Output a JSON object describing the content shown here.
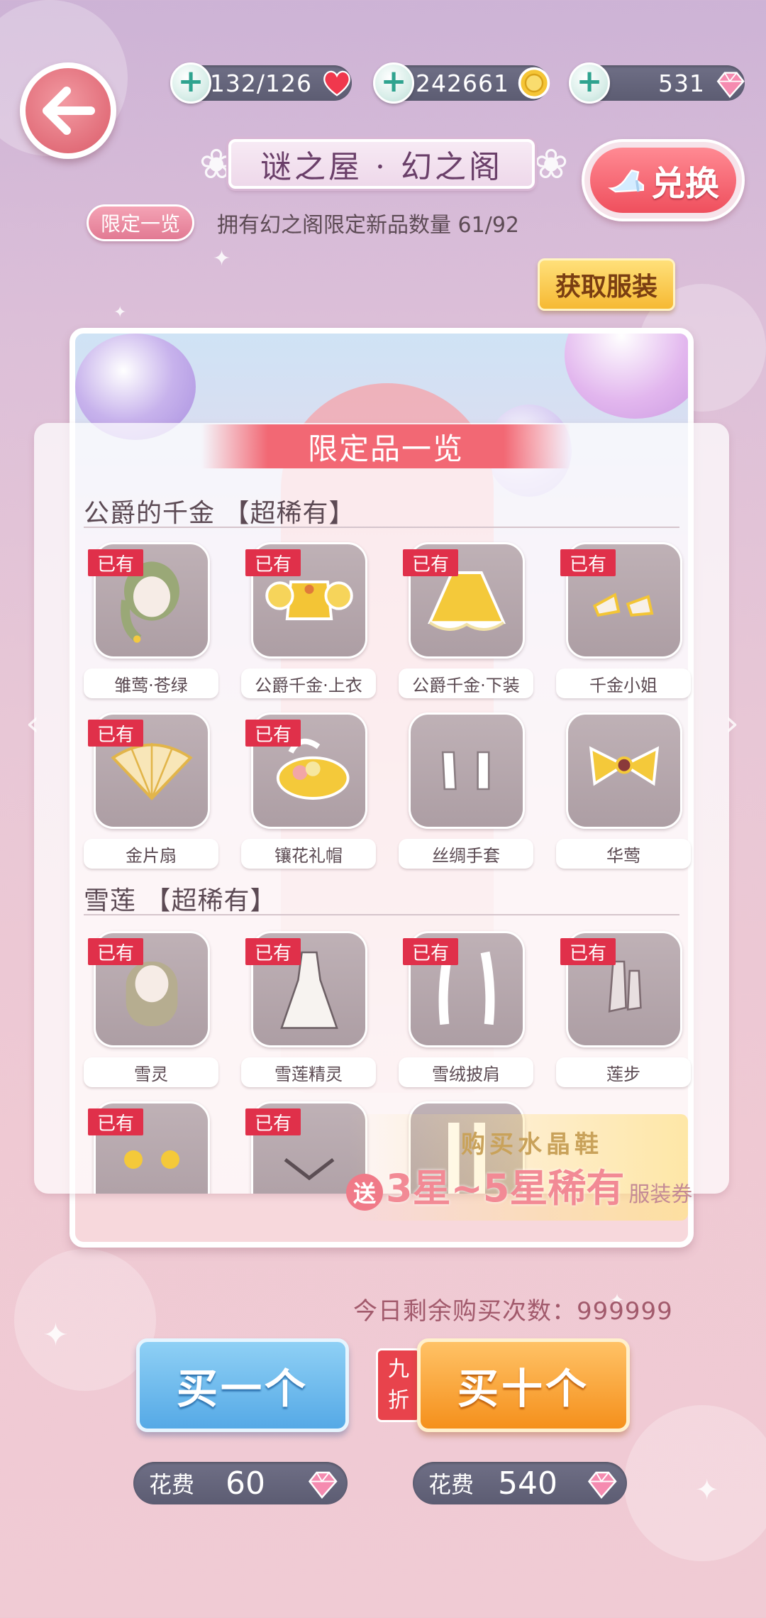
{
  "resources": {
    "stamina": "132/126",
    "gold": "242661",
    "diamonds": "531"
  },
  "header": {
    "title": "谜之屋 · 幻之阁",
    "exchange_label": "兑换",
    "limited_badge": "限定一览",
    "own_count": "拥有幻之阁限定新品数量 61/92",
    "get_clothes_label": "获取服装"
  },
  "panel": {
    "title": "限定品一览",
    "sections": [
      {
        "title": "公爵的千金 【超稀有】",
        "items": [
          {
            "name": "雏莺·苍绿",
            "owned": "已有",
            "icon": "hair-icon"
          },
          {
            "name": "公爵千金·上衣",
            "owned": "已有",
            "icon": "top-icon"
          },
          {
            "name": "公爵千金·下装",
            "owned": "已有",
            "icon": "skirt-icon"
          },
          {
            "name": "千金小姐",
            "owned": "已有",
            "icon": "shoes-icon"
          },
          {
            "name": "金片扇",
            "owned": "已有",
            "icon": "fan-icon"
          },
          {
            "name": "镶花礼帽",
            "owned": "已有",
            "icon": "hat-icon"
          },
          {
            "name": "丝绸手套",
            "owned": "",
            "icon": "gloves-icon"
          },
          {
            "name": "华莺",
            "owned": "",
            "icon": "bow-icon"
          }
        ]
      },
      {
        "title": "雪莲 【超稀有】",
        "items": [
          {
            "name": "雪灵",
            "owned": "已有",
            "icon": "hair-icon"
          },
          {
            "name": "雪莲精灵",
            "owned": "已有",
            "icon": "dress-icon"
          },
          {
            "name": "雪绒披肩",
            "owned": "已有",
            "icon": "shawl-icon"
          },
          {
            "name": "莲步",
            "owned": "已有",
            "icon": "boots-icon"
          },
          {
            "name": "",
            "owned": "已有",
            "icon": "flower-icon"
          },
          {
            "name": "",
            "owned": "已有",
            "icon": "necklace-icon"
          },
          {
            "name": "",
            "owned": "",
            "icon": "stockings-icon"
          }
        ]
      }
    ]
  },
  "promo": {
    "top": "购买水晶鞋",
    "send": "送",
    "main": "3星~5星稀有",
    "sub": "服装券"
  },
  "bottom": {
    "remaining": "今日剩余购买次数：999999",
    "buy_one": "买一个",
    "buy_ten": "买十个",
    "discount_1": "九",
    "discount_2": "折",
    "cost_label": "花费",
    "cost_one": "60",
    "cost_ten": "540"
  },
  "colors": {
    "accent_red": "#e0304a",
    "buy_one_blue": "#55a9e6",
    "buy_ten_orange": "#f5901c",
    "pill_gray": "#5c5c72"
  }
}
